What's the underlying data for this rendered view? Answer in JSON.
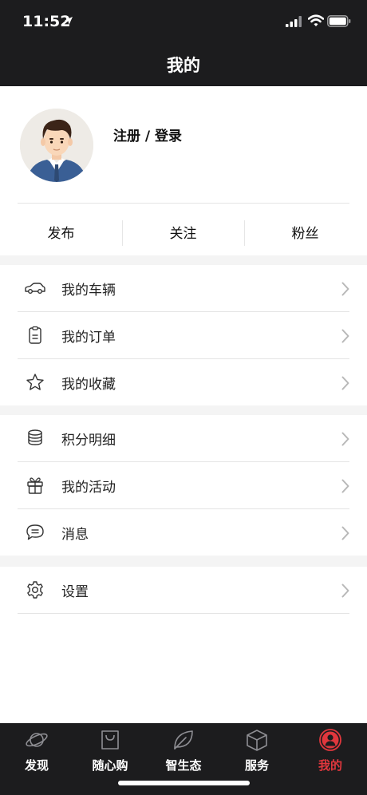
{
  "status_bar": {
    "time": "11:52"
  },
  "nav": {
    "title": "我的"
  },
  "profile": {
    "login_label": "注册 / 登录"
  },
  "stats": [
    "发布",
    "关注",
    "粉丝"
  ],
  "menu": {
    "group1": [
      {
        "label": "我的车辆",
        "icon": "car-icon"
      },
      {
        "label": "我的订单",
        "icon": "clipboard-icon"
      },
      {
        "label": "我的收藏",
        "icon": "star-icon"
      }
    ],
    "group2": [
      {
        "label": "积分明细",
        "icon": "coins-icon"
      },
      {
        "label": "我的活动",
        "icon": "gift-icon"
      },
      {
        "label": "消息",
        "icon": "message-icon"
      }
    ],
    "group3": [
      {
        "label": "设置",
        "icon": "gear-icon"
      }
    ]
  },
  "tabs": [
    {
      "label": "发现",
      "icon": "planet-icon"
    },
    {
      "label": "随心购",
      "icon": "shopping-bag-icon"
    },
    {
      "label": "智生态",
      "icon": "leaf-icon"
    },
    {
      "label": "服务",
      "icon": "box-icon"
    },
    {
      "label": "我的",
      "icon": "person-icon",
      "active": true
    }
  ],
  "colors": {
    "dark": "#1c1c1e",
    "accent": "#e0373d",
    "background": "#f4f4f4"
  }
}
